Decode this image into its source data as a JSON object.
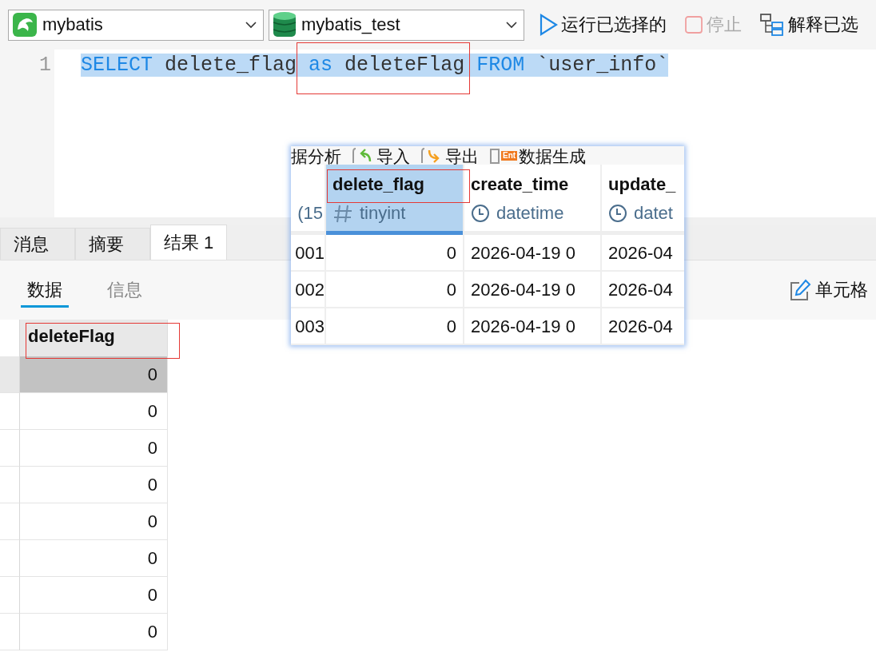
{
  "toolbar": {
    "connection": {
      "name": "mybatis"
    },
    "database": {
      "name": "mybatis_test"
    },
    "actions": [
      {
        "kind": "run",
        "label": "运行已选择的",
        "disabled": false
      },
      {
        "kind": "stop",
        "label": "停止",
        "disabled": true
      },
      {
        "kind": "explain",
        "label": "解释已选",
        "disabled": false
      }
    ]
  },
  "editor": {
    "lines": [
      {
        "number": "1",
        "selected": true,
        "segments": [
          {
            "highlighted": false,
            "tokens": [
              {
                "text": "SELECT",
                "kind": "keyword"
              },
              {
                "text": "delete_flag",
                "kind": "ident"
              }
            ]
          },
          {
            "highlighted": true,
            "tokens": [
              {
                "text": "as",
                "kind": "keyword"
              },
              {
                "text": "deleteFlag",
                "kind": "ident"
              }
            ]
          },
          {
            "highlighted": false,
            "tokens": [
              {
                "text": "FROM",
                "kind": "keyword"
              },
              {
                "text": "`user_info`",
                "kind": "ident"
              }
            ]
          }
        ]
      }
    ]
  },
  "result_tabs": [
    {
      "label": "消息",
      "selected": false
    },
    {
      "label": "摘要",
      "selected": false
    },
    {
      "label": "结果 1",
      "selected": true
    }
  ],
  "view_tabs": [
    {
      "label": "数据",
      "selected": true
    },
    {
      "label": "信息",
      "selected": false
    }
  ],
  "cell_edit_button": {
    "label": "单元格"
  },
  "grid": {
    "columns": [
      {
        "name": "deleteFlag",
        "highlighted": true
      }
    ],
    "rows": [
      {
        "value": "0",
        "selected": true
      },
      {
        "value": "0",
        "selected": false
      },
      {
        "value": "0",
        "selected": false
      },
      {
        "value": "0",
        "selected": false
      },
      {
        "value": "0",
        "selected": false
      },
      {
        "value": "0",
        "selected": false
      },
      {
        "value": "0",
        "selected": false
      },
      {
        "value": "0",
        "selected": false
      }
    ]
  },
  "inset": {
    "toolbar": [
      {
        "kind": "text",
        "label": "据分析"
      },
      {
        "kind": "import",
        "label": "导入"
      },
      {
        "kind": "export",
        "label": "导出"
      },
      {
        "kind": "generate",
        "label": "数据生成",
        "badge": "Ent"
      }
    ],
    "columns": [
      {
        "type": "(15",
        "kind": "text",
        "selected": false,
        "highlighted": false
      },
      {
        "name": "delete_flag",
        "type": "tinyint",
        "kind": "number",
        "selected": true,
        "highlighted": true
      },
      {
        "name": "create_time",
        "type": "datetime",
        "kind": "datetime",
        "selected": false,
        "highlighted": false
      },
      {
        "name": "update_",
        "type": "datet",
        "kind": "datetime",
        "selected": false,
        "highlighted": false
      }
    ],
    "rows": [
      [
        "001",
        "0",
        "2026-04-19 0",
        "2026-04"
      ],
      [
        "002",
        "0",
        "2026-04-19 0",
        "2026-04"
      ],
      [
        "003",
        "0",
        "2026-04-19 0",
        "2026-04"
      ]
    ]
  }
}
